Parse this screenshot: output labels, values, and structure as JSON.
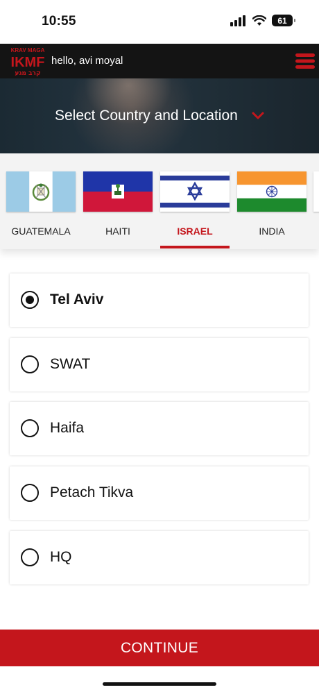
{
  "status_bar": {
    "time": "10:55",
    "battery": "61"
  },
  "header": {
    "logo_top": "KRAV MAGA",
    "logo_main": "IKMF",
    "logo_bottom": "קרב מגע",
    "greeting": "hello, avi moyal"
  },
  "hero": {
    "title": "Select Country and Location"
  },
  "countries": [
    {
      "name": "GUATEMALA",
      "selected": false
    },
    {
      "name": "HAITI",
      "selected": false
    },
    {
      "name": "ISRAEL",
      "selected": true
    },
    {
      "name": "INDIA",
      "selected": false
    }
  ],
  "locations": [
    {
      "name": "Tel Aviv",
      "selected": true
    },
    {
      "name": "SWAT",
      "selected": false
    },
    {
      "name": "Haifa",
      "selected": false
    },
    {
      "name": "Petach Tikva",
      "selected": false
    },
    {
      "name": "HQ",
      "selected": false
    }
  ],
  "continue_label": "CONTINUE",
  "colors": {
    "brand_red": "#c4161c",
    "header_bg": "#141414"
  }
}
